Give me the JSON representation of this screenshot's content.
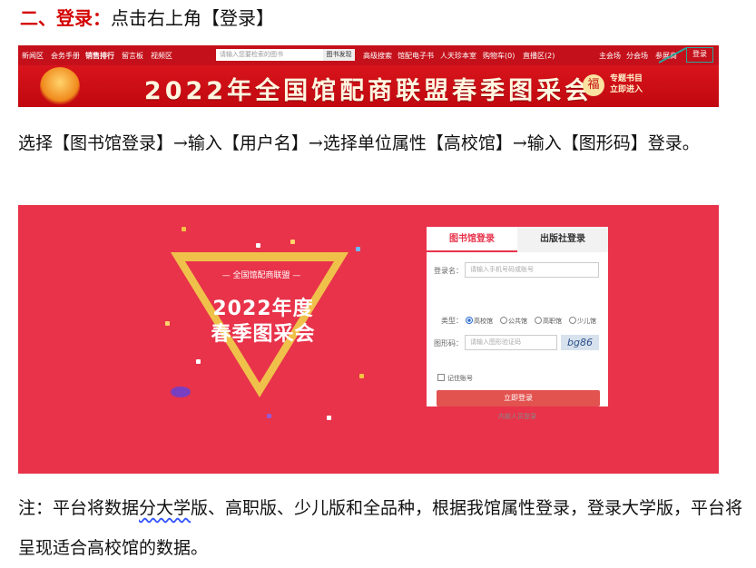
{
  "heading": {
    "num": "二、",
    "title": "登录：",
    "rest": "点击右上角【登录】"
  },
  "step_text": "选择【图书馆登录】→输入【用户名】→选择单位属性【高校馆】→输入【图形码】登录。",
  "shot1": {
    "nav_left": [
      "新闻区",
      "会务手册",
      "销售排行",
      "留言板",
      "视频区"
    ],
    "search_placeholder": "请输入您要检索的图书",
    "search_button": "图书发现",
    "nav_mid": [
      "高级搜索",
      "馆配电子书",
      "人天珍本室",
      "购物车(0)",
      "直播区(2)"
    ],
    "nav_right": [
      "主会场",
      "分会场",
      "参展商"
    ],
    "login": "登录",
    "banner_title": "2022年全国馆配商联盟春季图采会",
    "banner_side_1": "专题书目",
    "banner_side_2": "立即进入"
  },
  "shot2": {
    "brand_sub": "— 全国馆配商联盟 —",
    "brand_line1": "2022年度",
    "brand_line2": "春季图采会",
    "tab_library": "图书馆登录",
    "tab_publisher": "出版社登录",
    "username_label": "登录名：",
    "username_placeholder": "请输入手机号码或账号",
    "type_label": "类型：",
    "types": [
      "高校馆",
      "公共馆",
      "高职馆",
      "少儿馆"
    ],
    "captcha_label": "图形码：",
    "captcha_placeholder": "请输入图形验证码",
    "captcha_text": "bg86",
    "remember": "记住账号",
    "submit": "立即登录",
    "internal": "内部人员登录"
  },
  "note": {
    "a": "注：平台将数据",
    "b": "分大学",
    "c": "版、高职版、少儿版和全品种，根据我馆属性登录，登录大学版，平台将呈现适合高校馆的数据。"
  },
  "colors": {
    "heading_red": "#d40000",
    "banner_red": "#c4101a",
    "login_bg": "#e8334a",
    "login_box": "#2aa79b"
  }
}
